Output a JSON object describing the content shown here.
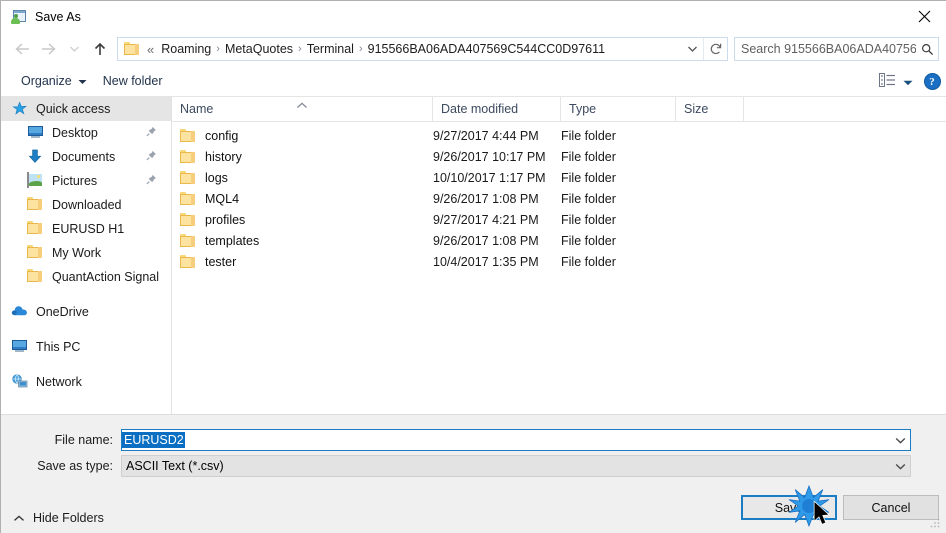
{
  "window": {
    "title": "Save As",
    "icon": "save-as-window-icon",
    "close_label": "✕"
  },
  "navigation": {
    "back_icon": "arrow-left-icon",
    "forward_icon": "arrow-right-icon",
    "recent_icon": "chevron-down-icon",
    "up_icon": "arrow-up-icon",
    "breadcrumb_prefix": "«",
    "breadcrumb": [
      "Roaming",
      "MetaQuotes",
      "Terminal",
      "915566BA06ADA407569C544CC0D97611"
    ],
    "separator": "›",
    "dropdown_icon": "chevron-down-icon",
    "refresh_icon": "refresh-icon"
  },
  "search": {
    "text": "Search 915566BA06ADA40756...",
    "icon": "search-icon"
  },
  "toolbar": {
    "organize_label": "Organize",
    "organize_caret": "▾",
    "new_folder_label": "New folder",
    "view_icon": "list-view-icon",
    "view_caret": "▾",
    "help_label": "?",
    "help_icon": "help-icon"
  },
  "sidebar": {
    "groups": [
      {
        "name": "quick-access",
        "label": "Quick access",
        "icon": "star-icon",
        "selected": true,
        "items": [
          {
            "label": "Desktop",
            "icon": "monitor-icon",
            "pinned": true
          },
          {
            "label": "Documents",
            "icon": "down-arrow-icon",
            "pinned": true
          },
          {
            "label": "Pictures",
            "icon": "picture-icon",
            "pinned": true
          },
          {
            "label": "Downloaded",
            "icon": "folder-icon",
            "pinned": false
          },
          {
            "label": "EURUSD H1",
            "icon": "folder-icon",
            "pinned": false
          },
          {
            "label": "My Work",
            "icon": "folder-icon",
            "pinned": false
          },
          {
            "label": "QuantAction Signal",
            "icon": "folder-icon",
            "pinned": false
          }
        ]
      },
      {
        "name": "onedrive",
        "label": "OneDrive",
        "icon": "cloud-icon",
        "selected": false,
        "items": []
      },
      {
        "name": "this-pc",
        "label": "This PC",
        "icon": "monitor-icon",
        "selected": false,
        "items": []
      },
      {
        "name": "network",
        "label": "Network",
        "icon": "network-icon",
        "selected": false,
        "items": []
      }
    ]
  },
  "file_list": {
    "columns": [
      "Name",
      "Date modified",
      "Type",
      "Size"
    ],
    "sort_column": "Name",
    "sort_caret": "˄",
    "rows": [
      {
        "name": "config",
        "date": "9/27/2017 4:44 PM",
        "type": "File folder",
        "size": ""
      },
      {
        "name": "history",
        "date": "9/26/2017 10:17 PM",
        "type": "File folder",
        "size": ""
      },
      {
        "name": "logs",
        "date": "10/10/2017 1:17 PM",
        "type": "File folder",
        "size": ""
      },
      {
        "name": "MQL4",
        "date": "9/26/2017 1:08 PM",
        "type": "File folder",
        "size": ""
      },
      {
        "name": "profiles",
        "date": "9/27/2017 4:21 PM",
        "type": "File folder",
        "size": ""
      },
      {
        "name": "templates",
        "date": "9/26/2017 1:08 PM",
        "type": "File folder",
        "size": ""
      },
      {
        "name": "tester",
        "date": "10/4/2017 1:35 PM",
        "type": "File folder",
        "size": ""
      }
    ]
  },
  "form": {
    "filename_label": "File name:",
    "filename_value": "EURUSD2",
    "filetype_label": "Save as type:",
    "filetype_value": "ASCII Text (*.csv)",
    "dropdown_icon": "chevron-down-icon"
  },
  "footer": {
    "hide_folders_label": "Hide Folders",
    "hide_folders_caret": "˄",
    "save_label": "Save",
    "cancel_label": "Cancel",
    "resize_grip_icon": "resize-grip-icon",
    "cursor_icon": "mouse-pointer-icon",
    "click_indicator_icon": "click-burst-icon"
  },
  "colors": {
    "accent": "#1a7dc4",
    "selection": "#0a6fc2",
    "folder": "#fde3a0",
    "panel": "#f0f0f0",
    "sidebar_selected": "#e5e5e5"
  }
}
